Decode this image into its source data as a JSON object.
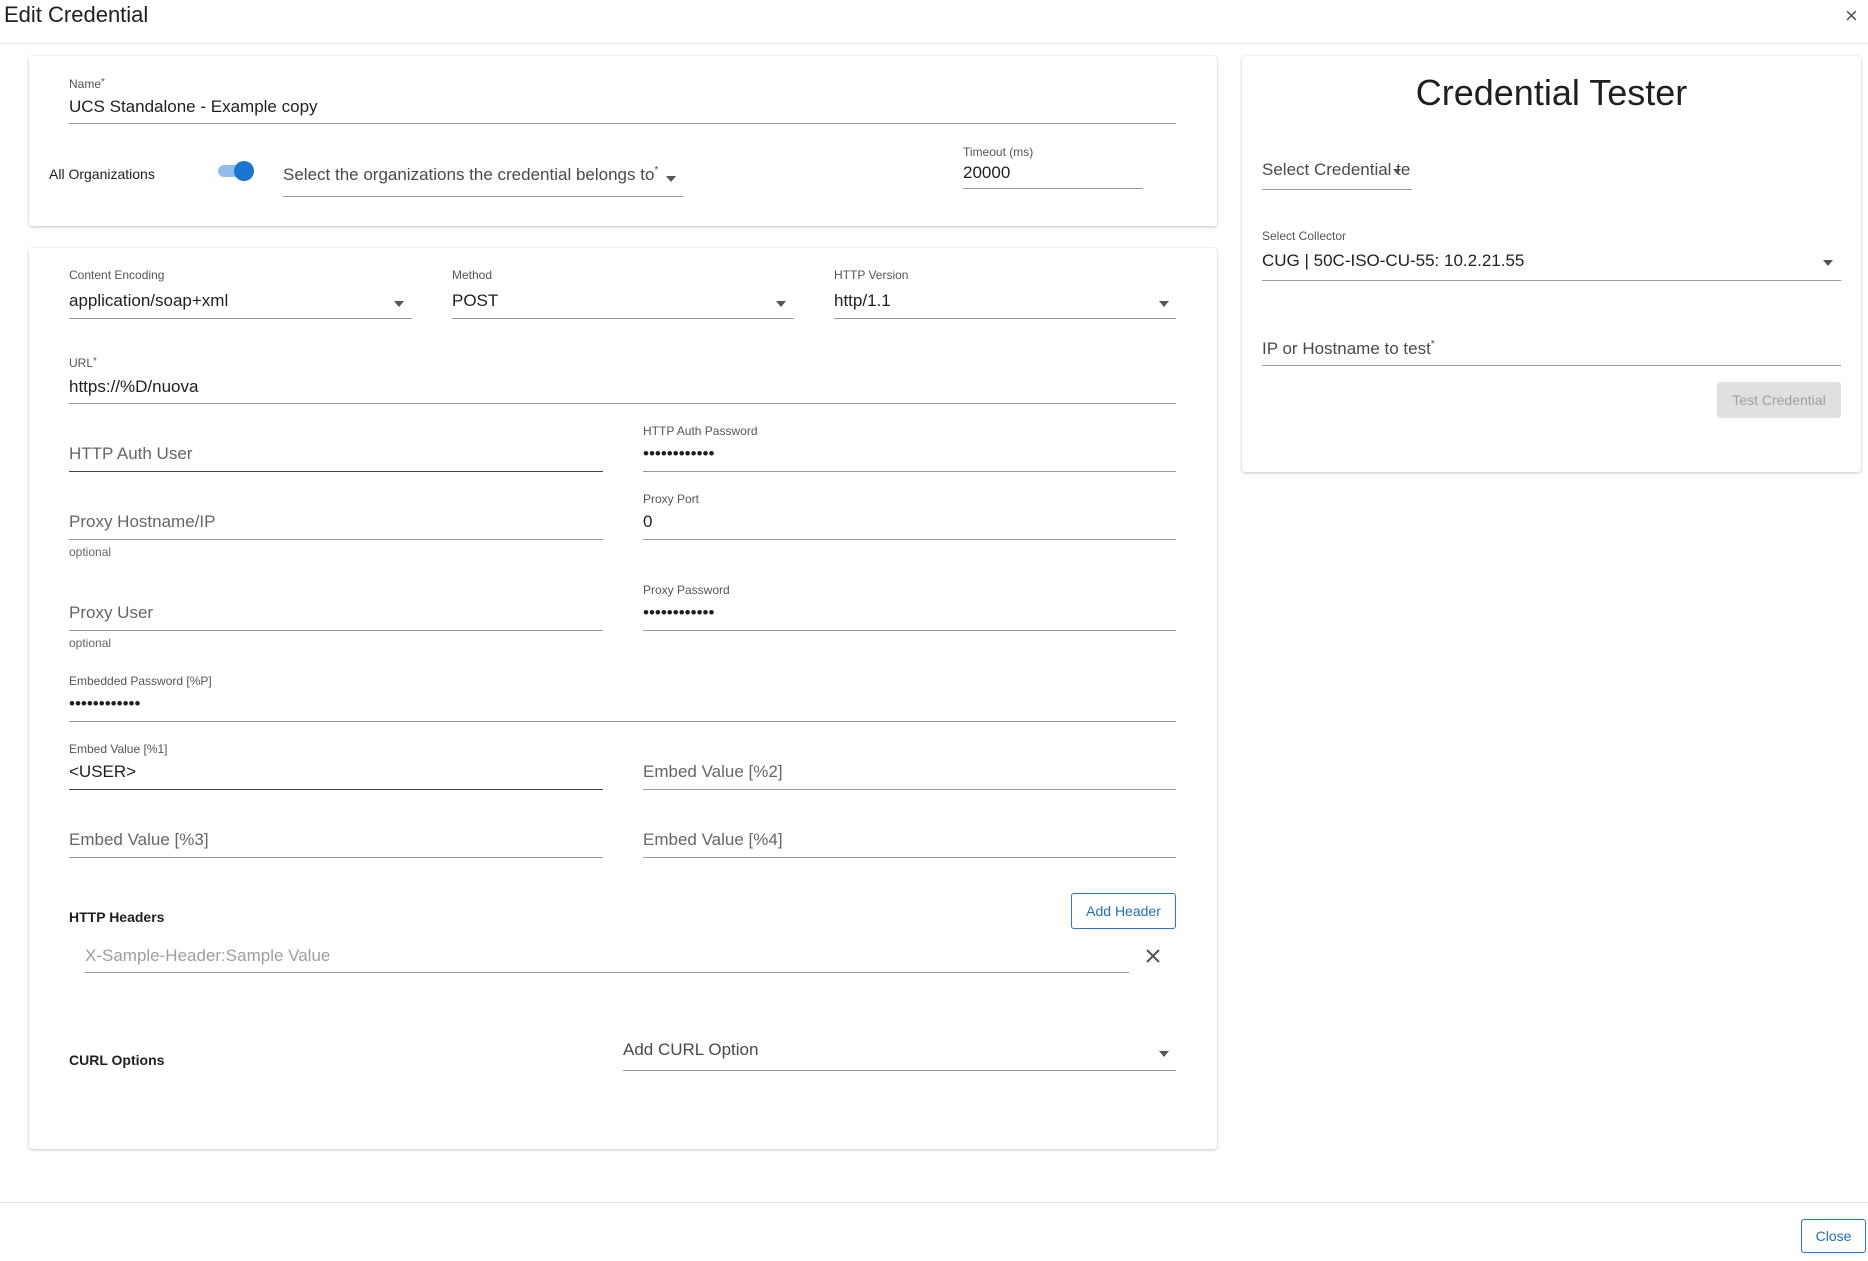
{
  "dialog": {
    "title": "Edit Credential",
    "close_symbol": "×"
  },
  "basic": {
    "name_label": "Name",
    "name_value": "UCS Standalone - Example copy",
    "all_orgs_label": "All Organizations",
    "all_orgs_on": true,
    "orgs_placeholder": "Select the organizations the credential belongs to",
    "timeout_label": "Timeout (ms)",
    "timeout_value": "20000"
  },
  "request": {
    "content_encoding_label": "Content Encoding",
    "content_encoding_value": "application/soap+xml",
    "method_label": "Method",
    "method_value": "POST",
    "http_version_label": "HTTP Version",
    "http_version_value": "http/1.1",
    "url_label": "URL",
    "url_value": "https://%D/nuova",
    "auth_user_placeholder": "HTTP Auth User",
    "auth_password_label": "HTTP Auth Password",
    "auth_password_value": "••••••••••••",
    "proxy_host_placeholder": "Proxy Hostname/IP",
    "proxy_host_hint": "optional",
    "proxy_port_label": "Proxy Port",
    "proxy_port_value": "0",
    "proxy_user_placeholder": "Proxy User",
    "proxy_user_hint": "optional",
    "proxy_password_label": "Proxy Password",
    "proxy_password_value": "••••••••••••",
    "embedded_password_label": "Embedded Password [%P]",
    "embedded_password_value": "••••••••••••",
    "embed1_label": "Embed Value [%1]",
    "embed1_value": "<USER>",
    "embed2_placeholder": "Embed Value [%2]",
    "embed3_placeholder": "Embed Value [%3]",
    "embed4_placeholder": "Embed Value [%4]",
    "headers_title": "HTTP Headers",
    "add_header_label": "Add Header",
    "header_placeholder": "X-Sample-Header:Sample Value",
    "curl_title": "CURL Options",
    "curl_placeholder": "Add CURL Option"
  },
  "tester": {
    "title": "Credential Tester",
    "select_credential_placeholder": "Select Credential te...",
    "collector_label": "Select Collector",
    "collector_value": "CUG | 50C-ISO-CU-55: 10.2.21.55",
    "ip_placeholder": "IP or Hostname to test",
    "test_button_label": "Test Credential"
  },
  "footer": {
    "close_label": "Close"
  },
  "colors": {
    "accent": "#1f6fc0",
    "toggle_track": "#90bdf0",
    "toggle_thumb": "#1976d2"
  }
}
